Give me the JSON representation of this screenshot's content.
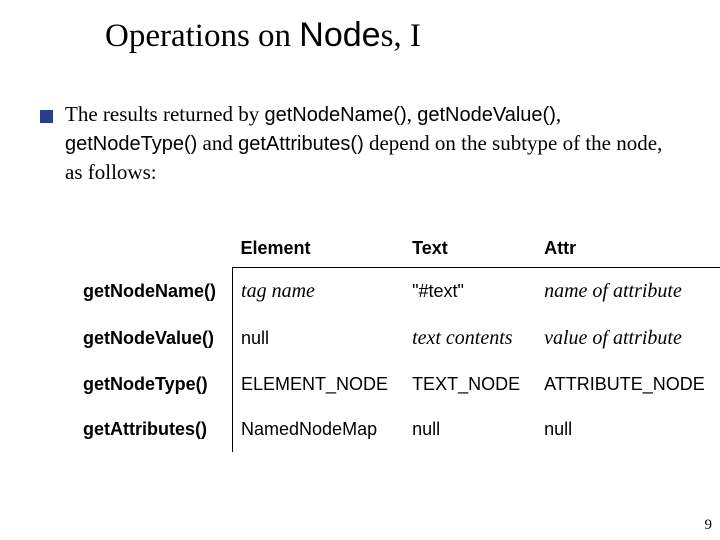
{
  "title": {
    "pre": "Operations on ",
    "node_word": "Node",
    "post": "s, I"
  },
  "body": {
    "t1": "The results returned by ",
    "c1": "getNodeName()",
    "t2": ", ",
    "c2": "getNodeValue()",
    "t3": ", ",
    "c3": "getNodeType()",
    "t4": " and ",
    "c4": "getAttributes()",
    "t5": " depend on the subtype of the node, as follows:"
  },
  "table": {
    "headers": {
      "c0": "",
      "c1": "Element",
      "c2": "Text",
      "c3": "Attr"
    },
    "rows": [
      {
        "label": "getNodeName()",
        "element": "tag name",
        "element_italic": true,
        "text": "\"#text\"",
        "text_italic": false,
        "attr": "name of attribute",
        "attr_italic": true
      },
      {
        "label": "getNodeValue()",
        "element": "null",
        "element_italic": false,
        "text": "text contents",
        "text_italic": true,
        "attr": "value of attribute",
        "attr_italic": true
      },
      {
        "label": "getNodeType()",
        "element": "ELEMENT_NODE",
        "element_italic": false,
        "text": "TEXT_NODE",
        "text_italic": false,
        "attr": "ATTRIBUTE_NODE",
        "attr_italic": false
      },
      {
        "label": "getAttributes()",
        "element": "NamedNodeMap",
        "element_italic": false,
        "text": "null",
        "text_italic": false,
        "attr": "null",
        "attr_italic": false
      }
    ]
  },
  "page_number": "9"
}
